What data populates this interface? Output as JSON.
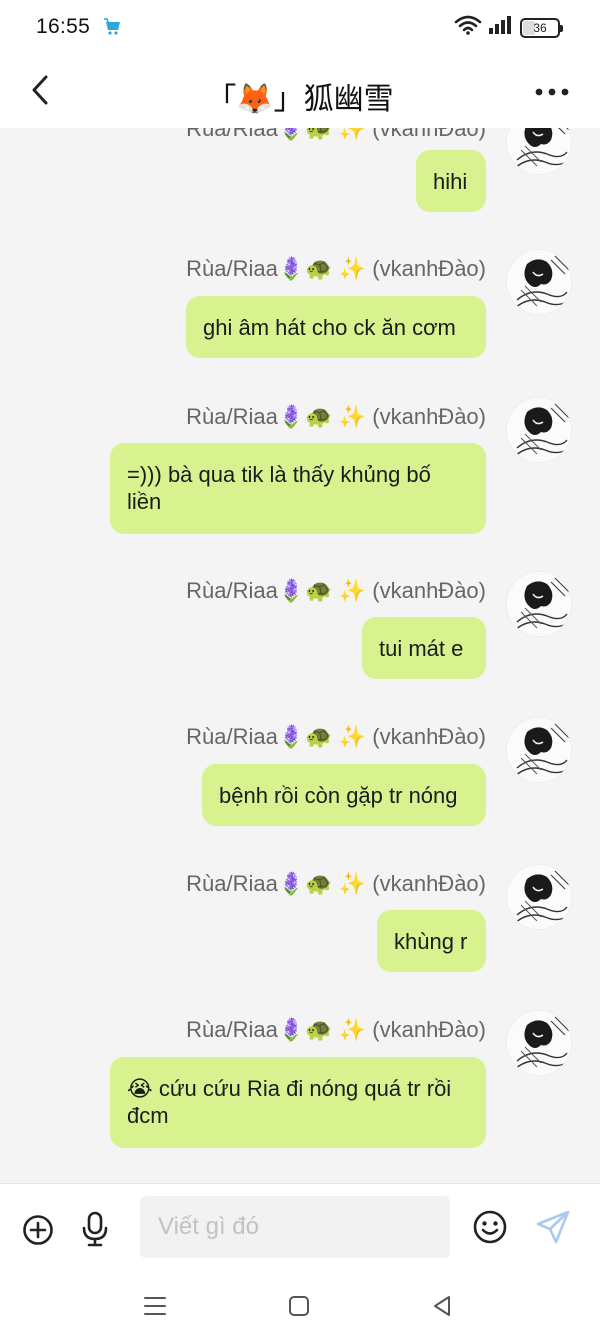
{
  "status_bar": {
    "time": "16:55",
    "battery": "36",
    "battery_level_percent": 36
  },
  "header": {
    "title": "「🦊」狐幽雪"
  },
  "messages": [
    {
      "sender": "Rùa/Riaa🪻🐢 ✨ (vkanhĐào)",
      "text": "hihi"
    },
    {
      "sender": "Rùa/Riaa🪻🐢 ✨ (vkanhĐào)",
      "text": "ghi âm hát cho ck ăn cơm"
    },
    {
      "sender": "Rùa/Riaa🪻🐢 ✨ (vkanhĐào)",
      "text": "=))) bà qua tik là thấy khủng bố liền"
    },
    {
      "sender": "Rùa/Riaa🪻🐢 ✨ (vkanhĐào)",
      "text": "tui mát e"
    },
    {
      "sender": "Rùa/Riaa🪻🐢 ✨ (vkanhĐào)",
      "text": "bệnh rồi còn gặp tr nóng"
    },
    {
      "sender": "Rùa/Riaa🪻🐢 ✨ (vkanhĐào)",
      "text": "khùng r"
    },
    {
      "sender": "Rùa/Riaa🪻🐢 ✨ (vkanhĐào)",
      "text": "😭 cứu cứu Ria đi nóng quá tr rồi đcm"
    }
  ],
  "input": {
    "placeholder": "Viết gì đó",
    "value": ""
  },
  "icons": {
    "back": "back-icon",
    "more": "more-icon",
    "plus": "plus-circle-icon",
    "mic": "mic-icon",
    "emoji": "emoji-icon",
    "send": "send-icon",
    "nav_menu": "menu-icon",
    "nav_home": "home-icon",
    "nav_back": "nav-back-icon"
  },
  "colors": {
    "bubble": "#d7f28f",
    "chat_background": "#f4f4f4",
    "send_icon": "#a9c9ef"
  }
}
